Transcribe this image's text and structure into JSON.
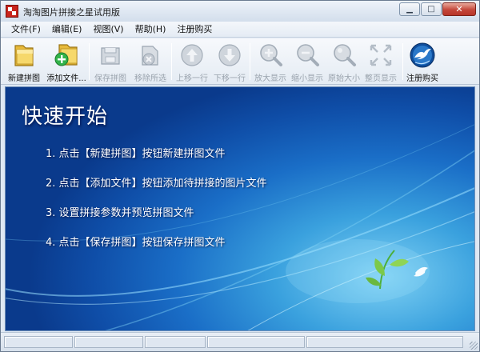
{
  "window": {
    "title": "淘淘图片拼接之星试用版",
    "controls": {
      "minimize": "▁",
      "maximize": "□",
      "close": "✕"
    }
  },
  "menu": [
    "文件(F)",
    "编辑(E)",
    "视图(V)",
    "帮助(H)",
    "注册购买"
  ],
  "toolbar": {
    "new_mosaic": "新建拼图",
    "add_file": "添加文件...",
    "save_mosaic": "保存拼图",
    "remove_selected": "移除所选",
    "move_up": "上移一行",
    "move_down": "下移一行",
    "zoom_in": "放大显示",
    "zoom_out": "缩小显示",
    "original_size": "原始大小",
    "fit_page": "整页显示",
    "register_buy": "注册购买"
  },
  "content": {
    "title": "快速开始",
    "steps": [
      "1.  点击【新建拼图】按钮新建拼图文件",
      "2.  点击【添加文件】按钮添加待拼接的图片文件",
      "3.  设置拼接参数并预览拼图文件",
      "4.  点击【保存拼图】按钮保存拼图文件"
    ]
  },
  "colors": {
    "accent_blue": "#1a6ec7",
    "close_red": "#c5473a",
    "folder_gold": "#e7b93a",
    "add_green": "#32b34a"
  },
  "icons": {
    "new_mosaic": "folder-new-icon",
    "add_file": "folder-add-icon",
    "save_mosaic": "save-icon",
    "remove_selected": "remove-icon",
    "move_up": "arrow-up-icon",
    "move_down": "arrow-down-icon",
    "zoom_in": "zoom-in-icon",
    "zoom_out": "zoom-out-icon",
    "original_size": "magnifier-icon",
    "fit_page": "fit-page-icon",
    "register_buy": "bird-globe-icon"
  }
}
